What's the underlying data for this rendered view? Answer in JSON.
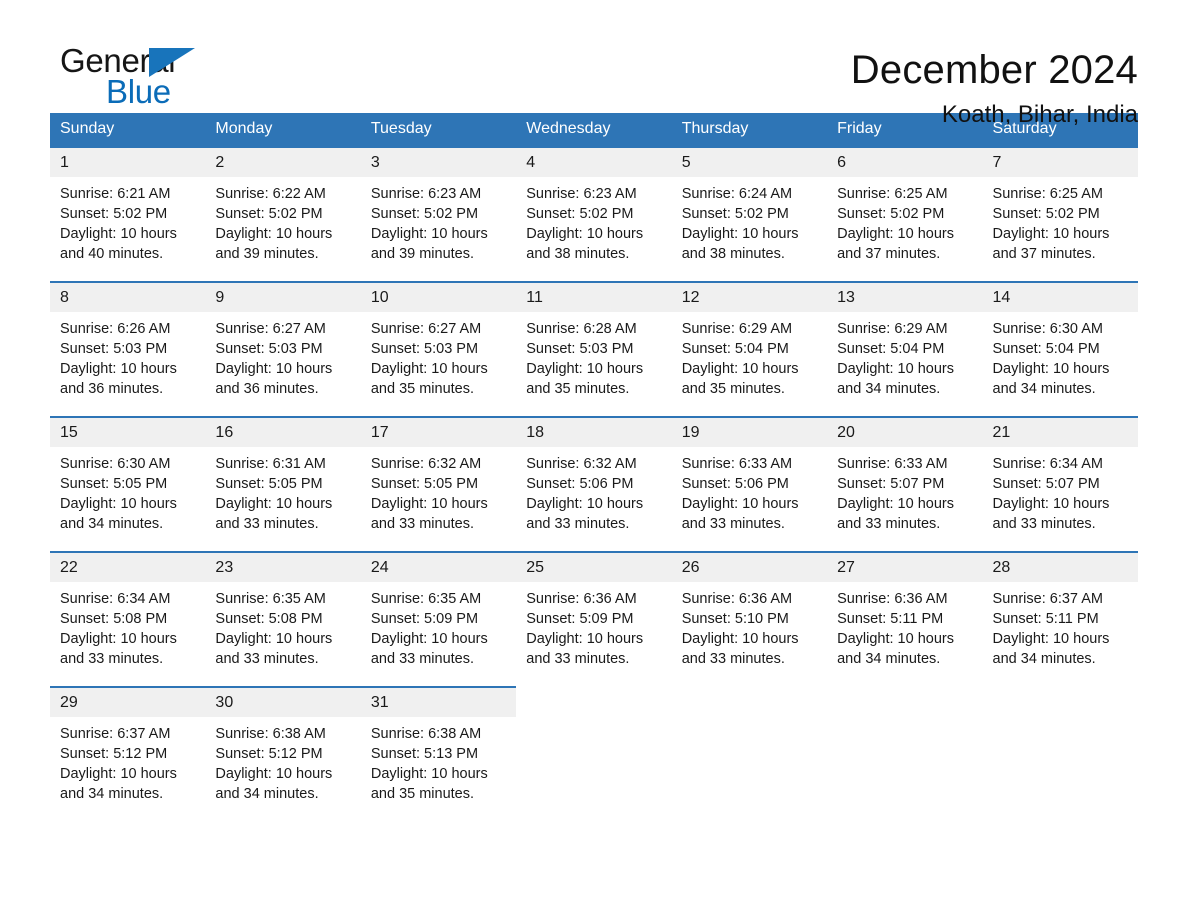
{
  "brand": {
    "name_part1": "General",
    "name_part2": "Blue",
    "flag_icon": "triangle-flag-icon",
    "accent_color": "#1874bb"
  },
  "header": {
    "title": "December 2024",
    "location": "Koath, Bihar, India"
  },
  "theme": {
    "header_blue": "#2e75b6",
    "daynum_band": "#f0f0f0",
    "text": "#1a1a1a"
  },
  "calendar": {
    "weekday_headers": [
      "Sunday",
      "Monday",
      "Tuesday",
      "Wednesday",
      "Thursday",
      "Friday",
      "Saturday"
    ],
    "weeks": [
      [
        {
          "day": "1",
          "sunrise": "Sunrise: 6:21 AM",
          "sunset": "Sunset: 5:02 PM",
          "daylight": "Daylight: 10 hours and 40 minutes."
        },
        {
          "day": "2",
          "sunrise": "Sunrise: 6:22 AM",
          "sunset": "Sunset: 5:02 PM",
          "daylight": "Daylight: 10 hours and 39 minutes."
        },
        {
          "day": "3",
          "sunrise": "Sunrise: 6:23 AM",
          "sunset": "Sunset: 5:02 PM",
          "daylight": "Daylight: 10 hours and 39 minutes."
        },
        {
          "day": "4",
          "sunrise": "Sunrise: 6:23 AM",
          "sunset": "Sunset: 5:02 PM",
          "daylight": "Daylight: 10 hours and 38 minutes."
        },
        {
          "day": "5",
          "sunrise": "Sunrise: 6:24 AM",
          "sunset": "Sunset: 5:02 PM",
          "daylight": "Daylight: 10 hours and 38 minutes."
        },
        {
          "day": "6",
          "sunrise": "Sunrise: 6:25 AM",
          "sunset": "Sunset: 5:02 PM",
          "daylight": "Daylight: 10 hours and 37 minutes."
        },
        {
          "day": "7",
          "sunrise": "Sunrise: 6:25 AM",
          "sunset": "Sunset: 5:02 PM",
          "daylight": "Daylight: 10 hours and 37 minutes."
        }
      ],
      [
        {
          "day": "8",
          "sunrise": "Sunrise: 6:26 AM",
          "sunset": "Sunset: 5:03 PM",
          "daylight": "Daylight: 10 hours and 36 minutes."
        },
        {
          "day": "9",
          "sunrise": "Sunrise: 6:27 AM",
          "sunset": "Sunset: 5:03 PM",
          "daylight": "Daylight: 10 hours and 36 minutes."
        },
        {
          "day": "10",
          "sunrise": "Sunrise: 6:27 AM",
          "sunset": "Sunset: 5:03 PM",
          "daylight": "Daylight: 10 hours and 35 minutes."
        },
        {
          "day": "11",
          "sunrise": "Sunrise: 6:28 AM",
          "sunset": "Sunset: 5:03 PM",
          "daylight": "Daylight: 10 hours and 35 minutes."
        },
        {
          "day": "12",
          "sunrise": "Sunrise: 6:29 AM",
          "sunset": "Sunset: 5:04 PM",
          "daylight": "Daylight: 10 hours and 35 minutes."
        },
        {
          "day": "13",
          "sunrise": "Sunrise: 6:29 AM",
          "sunset": "Sunset: 5:04 PM",
          "daylight": "Daylight: 10 hours and 34 minutes."
        },
        {
          "day": "14",
          "sunrise": "Sunrise: 6:30 AM",
          "sunset": "Sunset: 5:04 PM",
          "daylight": "Daylight: 10 hours and 34 minutes."
        }
      ],
      [
        {
          "day": "15",
          "sunrise": "Sunrise: 6:30 AM",
          "sunset": "Sunset: 5:05 PM",
          "daylight": "Daylight: 10 hours and 34 minutes."
        },
        {
          "day": "16",
          "sunrise": "Sunrise: 6:31 AM",
          "sunset": "Sunset: 5:05 PM",
          "daylight": "Daylight: 10 hours and 33 minutes."
        },
        {
          "day": "17",
          "sunrise": "Sunrise: 6:32 AM",
          "sunset": "Sunset: 5:05 PM",
          "daylight": "Daylight: 10 hours and 33 minutes."
        },
        {
          "day": "18",
          "sunrise": "Sunrise: 6:32 AM",
          "sunset": "Sunset: 5:06 PM",
          "daylight": "Daylight: 10 hours and 33 minutes."
        },
        {
          "day": "19",
          "sunrise": "Sunrise: 6:33 AM",
          "sunset": "Sunset: 5:06 PM",
          "daylight": "Daylight: 10 hours and 33 minutes."
        },
        {
          "day": "20",
          "sunrise": "Sunrise: 6:33 AM",
          "sunset": "Sunset: 5:07 PM",
          "daylight": "Daylight: 10 hours and 33 minutes."
        },
        {
          "day": "21",
          "sunrise": "Sunrise: 6:34 AM",
          "sunset": "Sunset: 5:07 PM",
          "daylight": "Daylight: 10 hours and 33 minutes."
        }
      ],
      [
        {
          "day": "22",
          "sunrise": "Sunrise: 6:34 AM",
          "sunset": "Sunset: 5:08 PM",
          "daylight": "Daylight: 10 hours and 33 minutes."
        },
        {
          "day": "23",
          "sunrise": "Sunrise: 6:35 AM",
          "sunset": "Sunset: 5:08 PM",
          "daylight": "Daylight: 10 hours and 33 minutes."
        },
        {
          "day": "24",
          "sunrise": "Sunrise: 6:35 AM",
          "sunset": "Sunset: 5:09 PM",
          "daylight": "Daylight: 10 hours and 33 minutes."
        },
        {
          "day": "25",
          "sunrise": "Sunrise: 6:36 AM",
          "sunset": "Sunset: 5:09 PM",
          "daylight": "Daylight: 10 hours and 33 minutes."
        },
        {
          "day": "26",
          "sunrise": "Sunrise: 6:36 AM",
          "sunset": "Sunset: 5:10 PM",
          "daylight": "Daylight: 10 hours and 33 minutes."
        },
        {
          "day": "27",
          "sunrise": "Sunrise: 6:36 AM",
          "sunset": "Sunset: 5:11 PM",
          "daylight": "Daylight: 10 hours and 34 minutes."
        },
        {
          "day": "28",
          "sunrise": "Sunrise: 6:37 AM",
          "sunset": "Sunset: 5:11 PM",
          "daylight": "Daylight: 10 hours and 34 minutes."
        }
      ],
      [
        {
          "day": "29",
          "sunrise": "Sunrise: 6:37 AM",
          "sunset": "Sunset: 5:12 PM",
          "daylight": "Daylight: 10 hours and 34 minutes."
        },
        {
          "day": "30",
          "sunrise": "Sunrise: 6:38 AM",
          "sunset": "Sunset: 5:12 PM",
          "daylight": "Daylight: 10 hours and 34 minutes."
        },
        {
          "day": "31",
          "sunrise": "Sunrise: 6:38 AM",
          "sunset": "Sunset: 5:13 PM",
          "daylight": "Daylight: 10 hours and 35 minutes."
        },
        null,
        null,
        null,
        null
      ]
    ]
  }
}
